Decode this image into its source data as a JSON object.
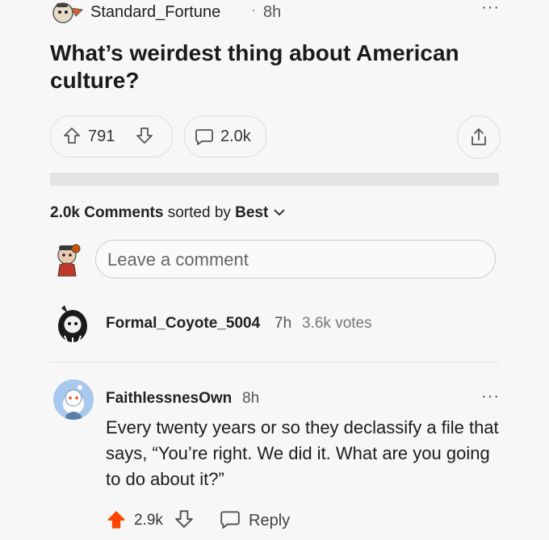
{
  "post": {
    "username": "Standard_Fortune",
    "separator": "·",
    "age": "8h",
    "more": "···",
    "title": "What’s weirdest thing about American culture?",
    "upvotes": "791",
    "comments": "2.0k"
  },
  "comments_section": {
    "count": "2.0k",
    "comments_word": "Comments",
    "sorted_by": "sorted by",
    "sort_value": "Best",
    "input_placeholder": "Leave a comment"
  },
  "comments": [
    {
      "username": "Formal_Coyote_5004",
      "age": "7h",
      "votes": "3.6k votes"
    },
    {
      "username": "FaithlessnesOwn",
      "age": "8h",
      "more": "···",
      "body": "Every twenty years or so they declassify a file that says, “You’re right. We did it. What are you going to do about it?”",
      "score": "2.9k",
      "reply_label": "Reply"
    }
  ],
  "colors": {
    "upvote_active": "#ff4500",
    "avatar_blue": "#a8c8ee"
  }
}
